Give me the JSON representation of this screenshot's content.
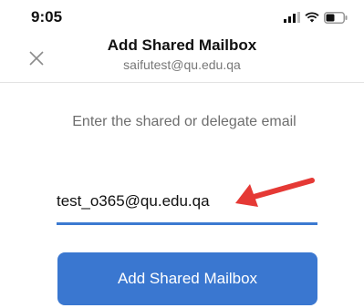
{
  "status_bar": {
    "time": "9:05",
    "icons": [
      "cellular-signal-icon",
      "wifi-icon",
      "battery-icon"
    ]
  },
  "header": {
    "title": "Add Shared Mailbox",
    "subtitle": "saifutest@qu.edu.qa",
    "close_icon": "close-icon"
  },
  "main": {
    "prompt": "Enter the shared or delegate email",
    "email_value": "test_o365@qu.edu.qa",
    "submit_label": "Add Shared Mailbox"
  },
  "annotation": {
    "arrow_color": "#e53935"
  },
  "colors": {
    "accent": "#3a77d0",
    "underline": "#3b7ad1"
  }
}
